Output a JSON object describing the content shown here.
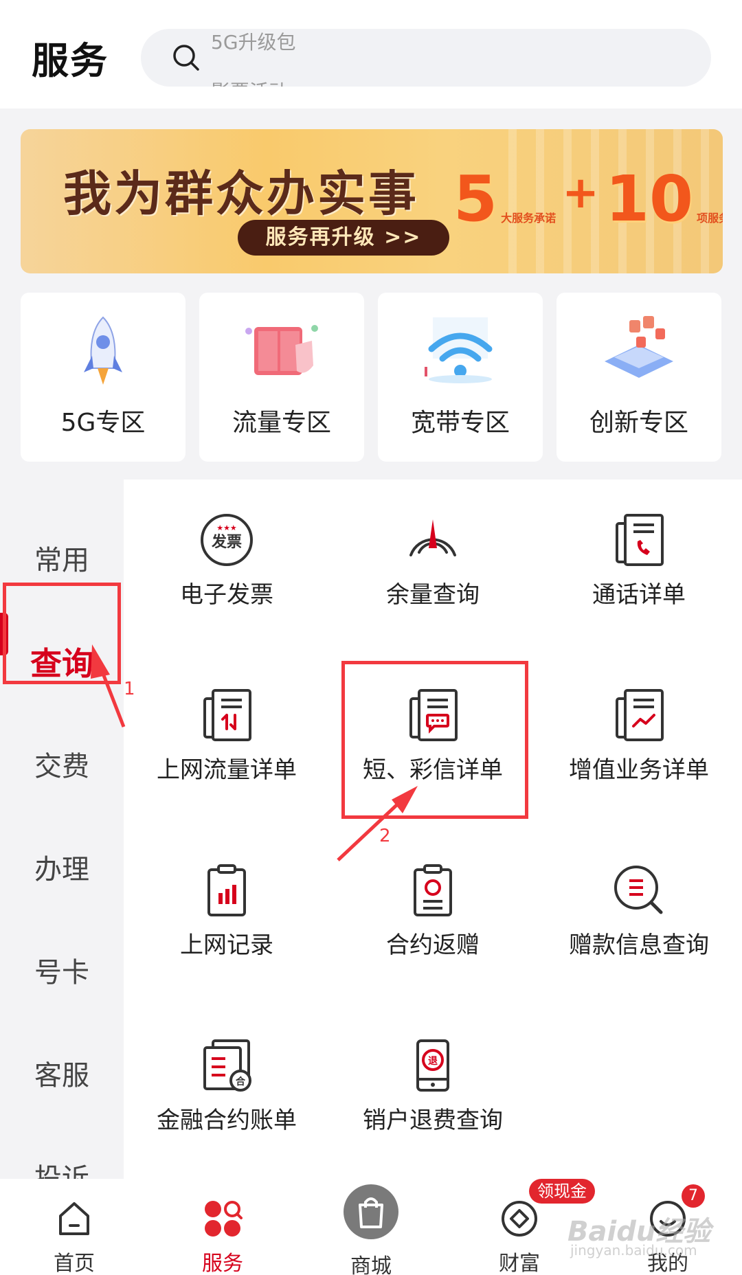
{
  "header": {
    "title": "服务",
    "search": {
      "hint_top": "5G升级包",
      "hint_bottom": "影票活动"
    }
  },
  "banner": {
    "title": "我为群众办实事",
    "button": "服务再升级 >>",
    "num1": "5",
    "plus": "+",
    "num2": "10",
    "caption1": "大服务承诺",
    "caption2": "项服务行动"
  },
  "zones": [
    {
      "label": "5G专区",
      "icon": "rocket-icon"
    },
    {
      "label": "流量专区",
      "icon": "data-box-icon"
    },
    {
      "label": "宽带专区",
      "icon": "wifi-icon"
    },
    {
      "label": "创新专区",
      "icon": "innovation-icon"
    }
  ],
  "categories": [
    "常用",
    "查询",
    "交费",
    "办理",
    "号卡",
    "客服",
    "投诉"
  ],
  "active_category": "查询",
  "services": [
    {
      "label": "电子发票",
      "icon": "invoice-icon"
    },
    {
      "label": "余量查询",
      "icon": "gauge-icon"
    },
    {
      "label": "通话详单",
      "icon": "call-detail-icon"
    },
    {
      "label": "上网流量详单",
      "icon": "data-detail-icon"
    },
    {
      "label": "短、彩信详单",
      "icon": "sms-detail-icon"
    },
    {
      "label": "增值业务详单",
      "icon": "vas-detail-icon"
    },
    {
      "label": "上网记录",
      "icon": "net-record-icon"
    },
    {
      "label": "合约返赠",
      "icon": "contract-rebate-icon"
    },
    {
      "label": "赠款信息查询",
      "icon": "gift-query-icon"
    },
    {
      "label": "金融合约账单",
      "icon": "finance-bill-icon"
    },
    {
      "label": "销户退费查询",
      "icon": "refund-query-icon"
    }
  ],
  "invoice_icon_text": "发票",
  "refund_icon_text": "退",
  "finance_icon_text": "合",
  "annotations": {
    "step1": "1",
    "step2": "2"
  },
  "tabbar": {
    "items": [
      {
        "label": "首页",
        "icon": "home-icon"
      },
      {
        "label": "服务",
        "icon": "service-icon"
      },
      {
        "label": "商城",
        "icon": "shopping-bag-icon"
      },
      {
        "label": "财富",
        "icon": "wealth-icon"
      },
      {
        "label": "我的",
        "icon": "profile-icon"
      }
    ],
    "active": "服务",
    "cash_badge": "领现金",
    "msg_count": "7"
  },
  "watermark": {
    "brand": "Baidu经验",
    "url": "jingyan.baidu.com"
  },
  "colors": {
    "brand_red": "#d6001c",
    "annotation_red": "#f2393f",
    "banner_orange": "#f2571c"
  }
}
